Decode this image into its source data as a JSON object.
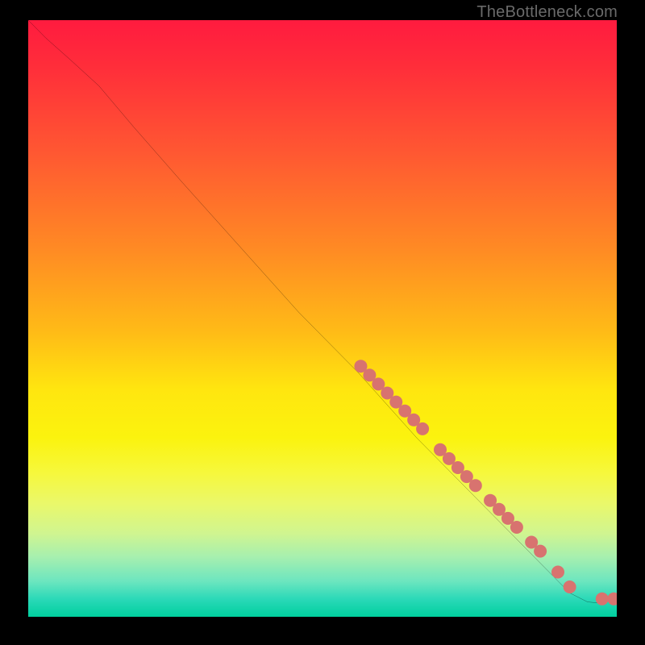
{
  "attribution": "TheBottleneck.com",
  "chart_data": {
    "type": "line",
    "title": "",
    "xlabel": "",
    "ylabel": "",
    "xlim": [
      0,
      100
    ],
    "ylim": [
      0,
      100
    ],
    "grid": false,
    "legend": false,
    "curve": [
      {
        "x": 0,
        "y": 100
      },
      {
        "x": 3,
        "y": 97
      },
      {
        "x": 7,
        "y": 93.5
      },
      {
        "x": 12,
        "y": 89
      },
      {
        "x": 18,
        "y": 82
      },
      {
        "x": 26,
        "y": 73
      },
      {
        "x": 36,
        "y": 62
      },
      {
        "x": 46,
        "y": 51
      },
      {
        "x": 56,
        "y": 41
      },
      {
        "x": 66,
        "y": 30
      },
      {
        "x": 76,
        "y": 20
      },
      {
        "x": 86,
        "y": 10
      },
      {
        "x": 92,
        "y": 4
      },
      {
        "x": 95,
        "y": 2.5
      },
      {
        "x": 97,
        "y": 2.3
      },
      {
        "x": 99,
        "y": 2.8
      },
      {
        "x": 100,
        "y": 3
      }
    ],
    "markers": [
      {
        "x": 56.5,
        "y": 42.0
      },
      {
        "x": 58.0,
        "y": 40.5
      },
      {
        "x": 59.5,
        "y": 39.0
      },
      {
        "x": 61.0,
        "y": 37.5
      },
      {
        "x": 62.5,
        "y": 36.0
      },
      {
        "x": 64.0,
        "y": 34.5
      },
      {
        "x": 65.5,
        "y": 33.0
      },
      {
        "x": 67.0,
        "y": 31.5
      },
      {
        "x": 70.0,
        "y": 28.0
      },
      {
        "x": 71.5,
        "y": 26.5
      },
      {
        "x": 73.0,
        "y": 25.0
      },
      {
        "x": 74.5,
        "y": 23.5
      },
      {
        "x": 76.0,
        "y": 22.0
      },
      {
        "x": 78.5,
        "y": 19.5
      },
      {
        "x": 80.0,
        "y": 18.0
      },
      {
        "x": 81.5,
        "y": 16.5
      },
      {
        "x": 83.0,
        "y": 15.0
      },
      {
        "x": 85.5,
        "y": 12.5
      },
      {
        "x": 87.0,
        "y": 11.0
      },
      {
        "x": 90.0,
        "y": 7.5
      },
      {
        "x": 92.0,
        "y": 5.0
      },
      {
        "x": 97.5,
        "y": 3.0
      },
      {
        "x": 99.5,
        "y": 3.0
      }
    ],
    "marker_color": "#d8736f",
    "line_color": "#000000",
    "line_width": 1.8
  }
}
